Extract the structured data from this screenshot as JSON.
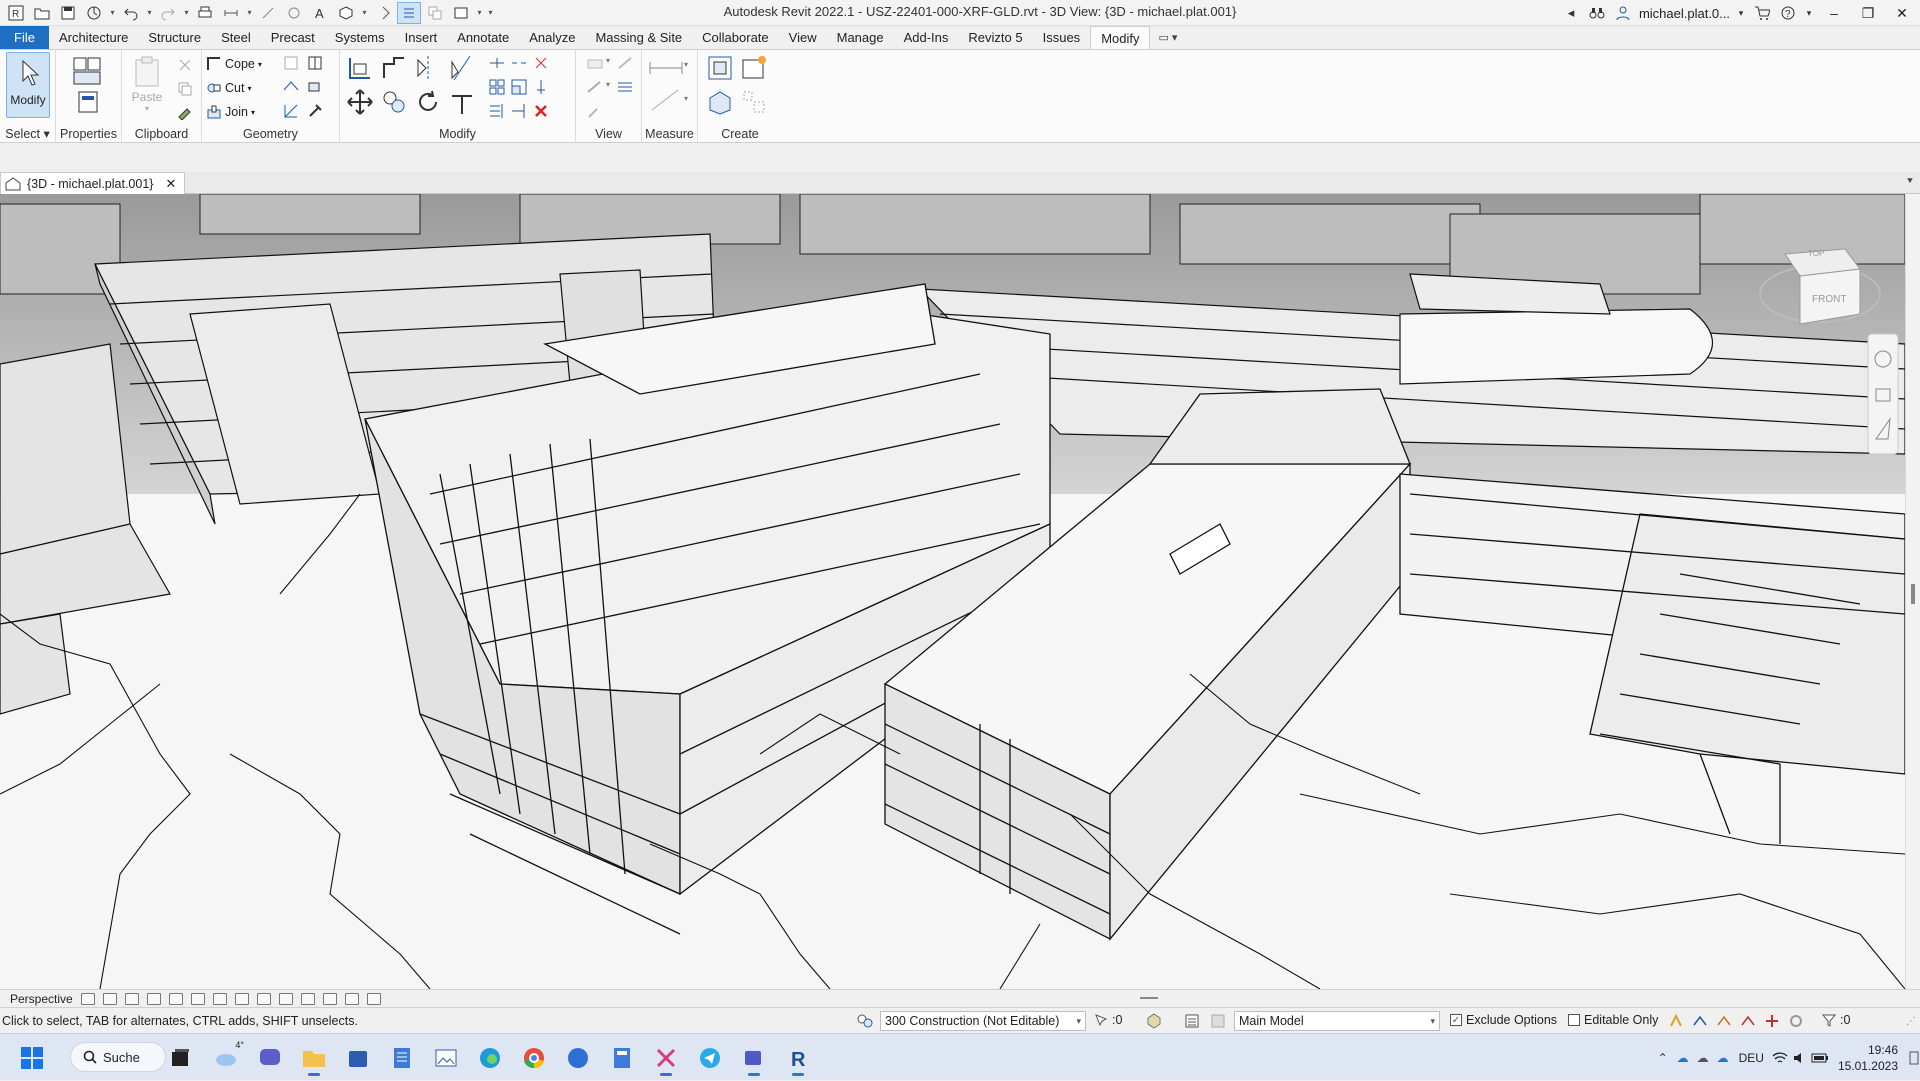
{
  "titlebar": {
    "app_title": "Autodesk Revit 2022.1 - USZ-22401-000-XRF-GLD.rvt - 3D View: {3D - michael.plat.001}",
    "user": "michael.plat.0...",
    "qat_icons": [
      "revit-logo-icon",
      "open-icon",
      "save-icon",
      "sync-icon",
      "undo-icon",
      "redo-icon",
      "print-icon",
      "measure-icon",
      "dimension-icon",
      "tag-icon",
      "text-icon",
      "3d-view-icon",
      "section-icon",
      "thin-lines-icon",
      "close-hidden-icon",
      "switch-windows-icon"
    ]
  },
  "ribbon_tabs": [
    "File",
    "Architecture",
    "Structure",
    "Steel",
    "Precast",
    "Systems",
    "Insert",
    "Annotate",
    "Analyze",
    "Massing & Site",
    "Collaborate",
    "View",
    "Manage",
    "Add-Ins",
    "Revizto 5",
    "Issues",
    "Modify"
  ],
  "active_tab": "Modify",
  "ribbon": {
    "select": {
      "label": "Select",
      "button": "Modify"
    },
    "properties": {
      "label": "Properties"
    },
    "clipboard": {
      "label": "Clipboard",
      "paste": "Paste"
    },
    "geometry": {
      "label": "Geometry",
      "cope": "Cope",
      "cut": "Cut",
      "join": "Join"
    },
    "modify": {
      "label": "Modify"
    },
    "view": {
      "label": "View"
    },
    "measure": {
      "label": "Measure"
    },
    "create": {
      "label": "Create"
    }
  },
  "view_tab": {
    "title": "{3D - michael.plat.001}"
  },
  "view_control": {
    "projection": "Perspective"
  },
  "statusbar": {
    "message": "Click to select, TAB for alternates, CTRL adds, SHIFT unselects.",
    "workset": "300 Construction (Not Editable)",
    "selection_count": ":0",
    "design_option": "Main Model",
    "exclude_options": "Exclude Options",
    "editable_only": "Editable Only",
    "filter_count": ":0"
  },
  "taskbar": {
    "search": "Suche",
    "weather": "4°",
    "language": "DEU",
    "time": "19:46",
    "date": "15.01.2023"
  },
  "viewcube": {
    "top": "TOP",
    "front": "FRONT"
  }
}
